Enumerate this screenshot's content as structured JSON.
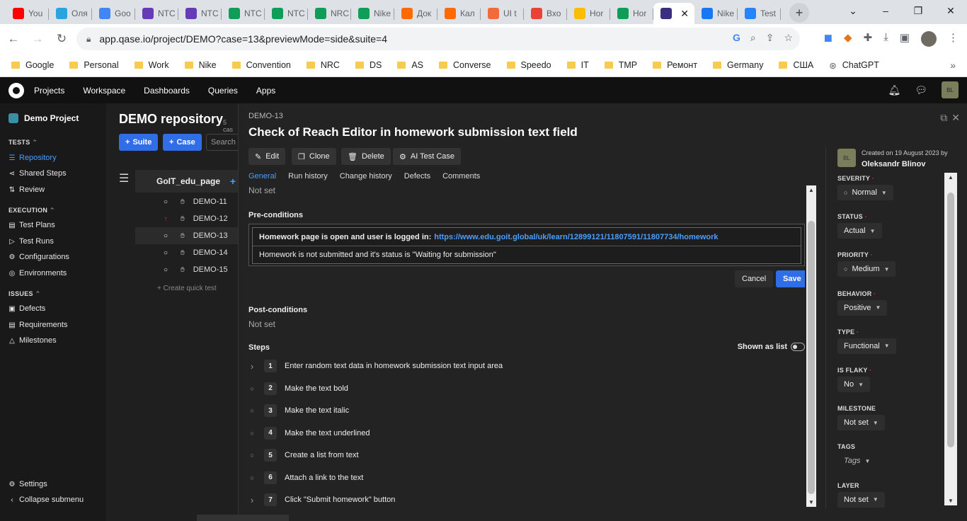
{
  "browser": {
    "tabs": [
      {
        "label": "You",
        "icon": "youtube-icon",
        "color": "#ff0000"
      },
      {
        "label": "Оля",
        "icon": "telegram-icon",
        "color": "#2aa3e0"
      },
      {
        "label": "Goo",
        "icon": "google-calendar-icon",
        "color": "#4285f4"
      },
      {
        "label": "NTC",
        "icon": "forms-icon",
        "color": "#673ab7"
      },
      {
        "label": "NTC",
        "icon": "forms-icon",
        "color": "#673ab7"
      },
      {
        "label": "NTC",
        "icon": "sheets-icon",
        "color": "#0f9d58"
      },
      {
        "label": "NTC",
        "icon": "sheets-icon",
        "color": "#0f9d58"
      },
      {
        "label": "NRC",
        "icon": "sheets-icon",
        "color": "#0f9d58"
      },
      {
        "label": "Nike",
        "icon": "sheets-icon",
        "color": "#0f9d58"
      },
      {
        "label": "Док",
        "icon": "generic-icon",
        "color": "#ff6a00"
      },
      {
        "label": "Кал",
        "icon": "generic-icon",
        "color": "#ff6a00"
      },
      {
        "label": "UI t",
        "icon": "generic-icon",
        "color": "#f26b3a"
      },
      {
        "label": "Вхо",
        "icon": "gmail-icon",
        "color": "#ea4335"
      },
      {
        "label": "Hor",
        "icon": "drive-icon",
        "color": "#fbbc04"
      },
      {
        "label": "Hor",
        "icon": "sheets-icon",
        "color": "#0f9d58"
      },
      {
        "label": "",
        "icon": "qase-icon",
        "color": "#3b2e7e",
        "active": true
      },
      {
        "label": "Nike",
        "icon": "facebook-icon",
        "color": "#1877f2"
      },
      {
        "label": "Test",
        "icon": "jira-icon",
        "color": "#2684ff"
      }
    ],
    "url": "app.qase.io/project/DEMO?case=13&previewMode=side&suite=4",
    "bookmarks": [
      "Google",
      "Personal",
      "Work",
      "Nike",
      "Convention",
      "NRC",
      "DS",
      "AS",
      "Converse",
      "Speedo",
      "IT",
      "TMP",
      "Ремонт",
      "Germany",
      "США",
      "ChatGPT"
    ]
  },
  "appbar": {
    "nav": [
      "Projects",
      "Workspace",
      "Dashboards",
      "Queries",
      "Apps"
    ],
    "user_initials": "BL"
  },
  "sidebar": {
    "project": "Demo Project",
    "sections": {
      "tests": "TESTS",
      "execution": "EXECUTION",
      "issues": "ISSUES"
    },
    "items": {
      "repository": "Repository",
      "shared_steps": "Shared Steps",
      "review": "Review",
      "test_plans": "Test Plans",
      "test_runs": "Test Runs",
      "configurations": "Configurations",
      "environments": "Environments",
      "defects": "Defects",
      "requirements": "Requirements",
      "milestones": "Milestones",
      "settings": "Settings",
      "collapse": "Collapse submenu"
    }
  },
  "repository": {
    "title": "DEMO repository",
    "subtitle": "5 cas",
    "suite_btn": "Suite",
    "case_btn": "Case",
    "search_placeholder": "Search f",
    "suite_name": "GoIT_edu_page",
    "cases": [
      {
        "id": "DEMO-11",
        "priority": "none"
      },
      {
        "id": "DEMO-12",
        "priority": "high"
      },
      {
        "id": "DEMO-13",
        "priority": "none"
      },
      {
        "id": "DEMO-14",
        "priority": "none"
      },
      {
        "id": "DEMO-15",
        "priority": "none"
      }
    ],
    "quick_create": "+ Create quick test"
  },
  "case": {
    "code": "DEMO-13",
    "title": "Check of Reach Editor in homework submission text field",
    "actions": [
      "Edit",
      "Clone",
      "Delete",
      "AI Test Case"
    ],
    "tabs": [
      "General",
      "Run history",
      "Change history",
      "Defects",
      "Comments"
    ],
    "top_not_set": "Not set",
    "preconditions_label": "Pre-conditions",
    "pre_row1_bold": "Homework page is open and user is logged in:",
    "pre_row1_link": "https://www.edu.goit.global/uk/learn/12899121/11807591/11807734/homework",
    "pre_row2": "Homework is not submitted and it's status is \"Waiting for submission\"",
    "cancel": "Cancel",
    "save": "Save",
    "postconditions_label": "Post-conditions",
    "post_not_set": "Not set",
    "steps_label": "Steps",
    "shown_as_list": "Shown as list",
    "steps": [
      {
        "num": "1",
        "text": "Enter random text data in homework submission text input area",
        "expandable": true
      },
      {
        "num": "2",
        "text": "Make the text bold",
        "expandable": false
      },
      {
        "num": "3",
        "text": "Make the text italic",
        "expandable": false
      },
      {
        "num": "4",
        "text": "Make the text underlined",
        "expandable": false
      },
      {
        "num": "5",
        "text": "Create a list from text",
        "expandable": false
      },
      {
        "num": "6",
        "text": "Attach a link to the text",
        "expandable": false
      },
      {
        "num": "7",
        "text": "Click \"Submit homework\" button",
        "expandable": true
      }
    ]
  },
  "meta": {
    "created_on": "Created on 19 August 2023 by",
    "author": "Oleksandr Blinov",
    "author_initials": "BL",
    "fields": [
      {
        "label": "SEVERITY",
        "value": "Normal",
        "required": true,
        "dot": true
      },
      {
        "label": "STATUS",
        "value": "Actual",
        "required": true,
        "dot": false
      },
      {
        "label": "PRIORITY",
        "value": "Medium",
        "required": true,
        "dot": true
      },
      {
        "label": "BEHAVIOR",
        "value": "Positive",
        "required": true,
        "dot": false
      },
      {
        "label": "TYPE",
        "value": "Functional",
        "required": true,
        "dot": false
      },
      {
        "label": "IS FLAKY",
        "value": "No",
        "required": true,
        "dot": false
      },
      {
        "label": "MILESTONE",
        "value": "Not set",
        "required": false,
        "dot": false
      },
      {
        "label": "TAGS",
        "value": "Tags",
        "required": false,
        "dot": false,
        "italic": true
      },
      {
        "label": "LAYER",
        "value": "Not set",
        "required": false,
        "dot": false
      }
    ]
  },
  "colors": {
    "accent": "#2f6ee6",
    "link": "#4a9eff",
    "required": "#dd3333"
  }
}
